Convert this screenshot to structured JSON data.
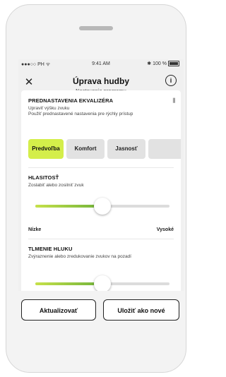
{
  "status_bar": {
    "carrier": "●●●○○ PH ᯤ",
    "time": "9:41 AM",
    "battery": "100 %"
  },
  "nav": {
    "title": "Úprava hudby",
    "subtitle": "Nastavenia programu"
  },
  "equalizer": {
    "title": "PREDNASTAVENIA EKVALIZÉRA",
    "description": "Upraviť výšku zvuku\nPoužiť prednastavené nastavenia pre rýchly prístup",
    "presets": [
      "Predvoľba",
      "Komfort",
      "Jasnosť",
      ""
    ],
    "selected": "Predvoľba",
    "accent": "#d4ee4a"
  },
  "volume": {
    "title": "HLASITOSŤ",
    "description": "Zoslabiť alebo zosilniť zvuk",
    "level": 0.5,
    "min_label": "Nízke",
    "max_label": "Vysoké"
  },
  "noise": {
    "title": "TLMENIE HLUKU",
    "description": "Zvýraznenie alebo zredukovanie zvukov na pozadí",
    "level": 0.5
  },
  "footer": {
    "update_label": "Aktualizovať",
    "save_new_label": "Uložiť ako nové"
  }
}
